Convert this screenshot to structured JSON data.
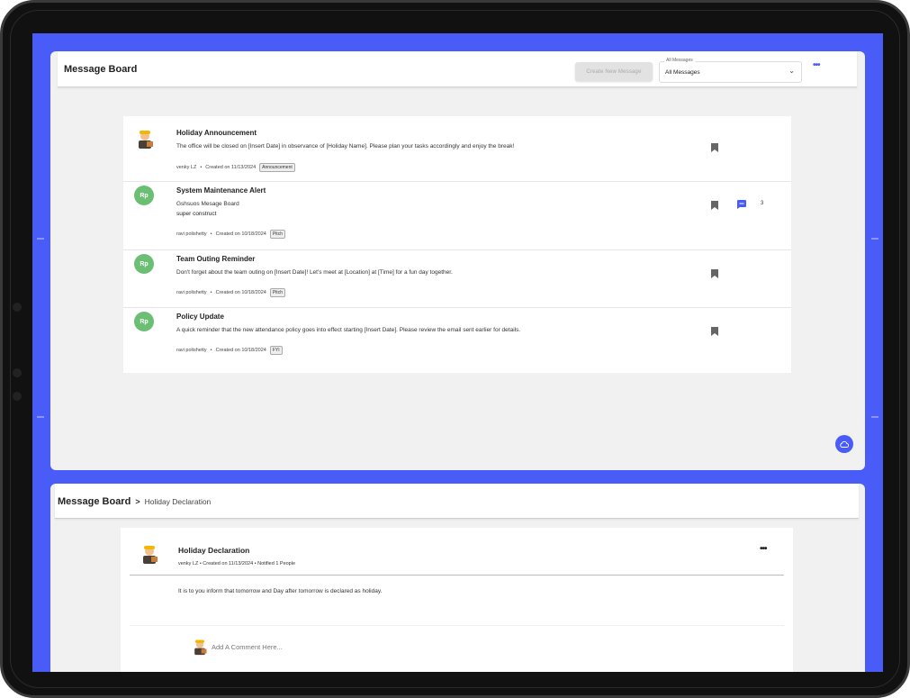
{
  "board": {
    "title": "Message Board",
    "create_button": "Create New Message",
    "filter": {
      "legend": "All Messages",
      "value": "All Messages"
    },
    "messages": [
      {
        "title": "Holiday Announcement",
        "body": "The office will be closed on [Insert Date] in observance of [Holiday Name]. Please plan your tasks accordingly and enjoy the break!",
        "body2": "",
        "author": "venky LZ",
        "created": "Created on 11/13/2024",
        "tag": "Announcement",
        "avatar": ""
      },
      {
        "title": "System Maintenance Alert",
        "body": "Gshsuos Mesage Board",
        "body2": "super construct",
        "author": "ravi polishetty",
        "created": "Created on 10/18/2024",
        "tag": "Pitch",
        "avatar": "Rp",
        "comment_count": "3"
      },
      {
        "title": "Team Outing Reminder",
        "body": "Don't forget about the team outing on [Insert Date]! Let's meet at [Location] at [Time] for a fun day together.",
        "body2": "",
        "author": "ravi polishetty",
        "created": "Created on 10/18/2024",
        "tag": "Pitch",
        "avatar": "Rp"
      },
      {
        "title": "Policy Update",
        "body": "A quick reminder that the new attendance policy goes into effect starting [Insert Date]. Please review the email sent earlier for details.",
        "body2": "",
        "author": "ravi polishetty",
        "created": "Created on 10/18/2024",
        "tag": "FYI",
        "avatar": "Rp"
      }
    ]
  },
  "detail": {
    "breadcrumb_root": "Message Board",
    "breadcrumb_sep": ">",
    "breadcrumb_current": "Holiday Declaration",
    "title": "Holiday Declaration",
    "meta": "venky LZ  •  Created on 11/13/2024  •  Notified 1 People",
    "body": "It is to you inform that tomorrow and Day after tomorrow is declared as holiday.",
    "comment_placeholder": "Add A Comment Here..."
  },
  "icons": {
    "bookmark": "bookmark-icon",
    "chat": "chat-icon",
    "more": "more-horizontal-icon",
    "chevron": "chevron-down-icon",
    "fab": "cloud-icon"
  },
  "colors": {
    "accent": "#4a5cf7",
    "avatar_green": "#6bbf73"
  }
}
